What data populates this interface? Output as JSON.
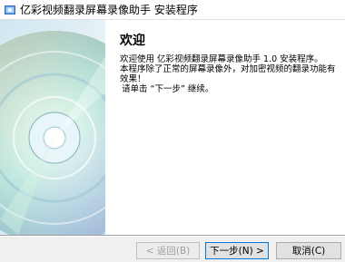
{
  "window": {
    "title": "亿彩视频翻录屏幕录像助手 安装程序"
  },
  "icons": {
    "app": "installer-app-icon",
    "banner": "cd-disc-image"
  },
  "content": {
    "heading": "欢迎",
    "line1": "欢迎使用 亿彩视频翻录屏幕录像助手 1.0 安装程序。",
    "line2": "本程序除了正常的屏幕录像外，对加密视频的翻录功能有效果！",
    "line3": "请单击 “下一步” 继续。"
  },
  "buttons": {
    "back": "< 返回(B)",
    "next": "下一步(N) >",
    "cancel": "取消(C)"
  },
  "colors": {
    "accent": "#0078d7"
  }
}
